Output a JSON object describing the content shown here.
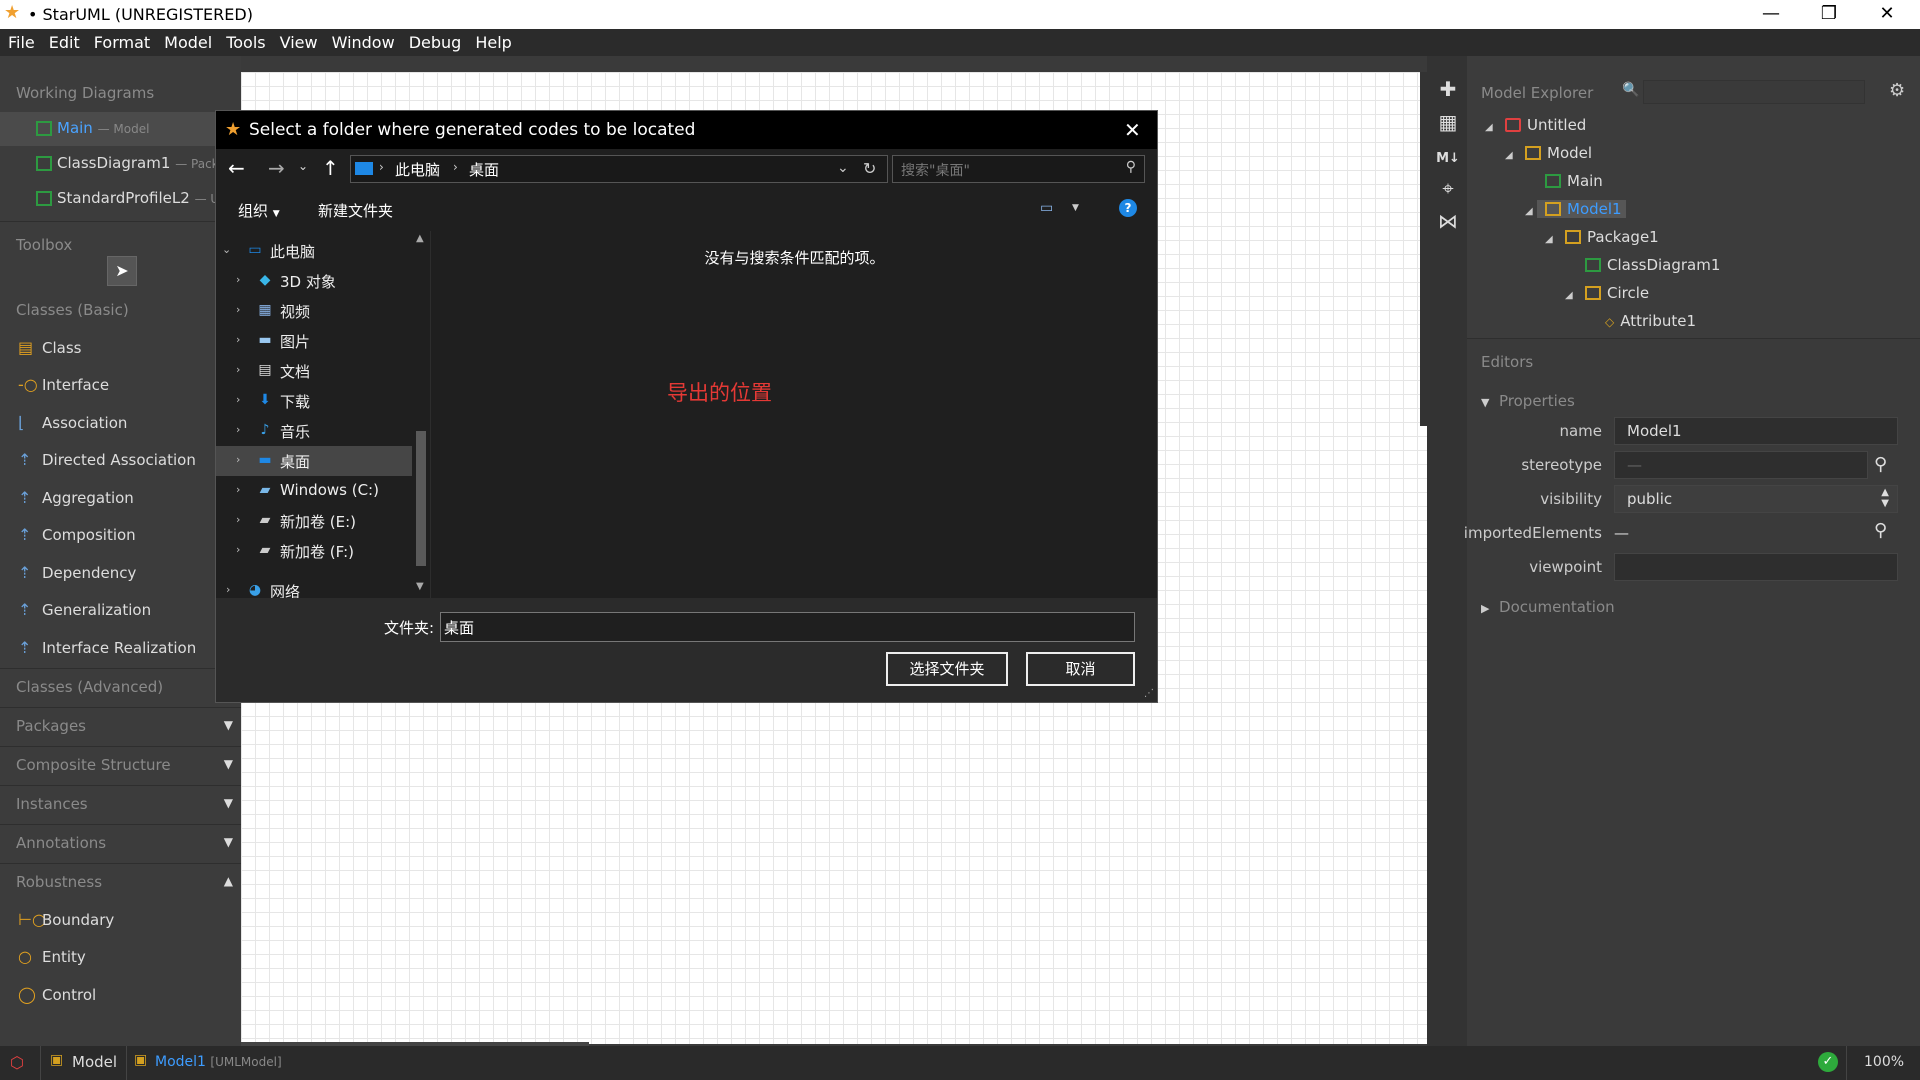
{
  "window": {
    "title": "• StarUML (UNREGISTERED)",
    "controls": [
      "minimize-icon",
      "restore-icon",
      "close-icon"
    ]
  },
  "menu": [
    "File",
    "Edit",
    "Format",
    "Model",
    "Tools",
    "View",
    "Window",
    "Debug",
    "Help"
  ],
  "working_diagrams": {
    "title": "Working Diagrams",
    "items": [
      {
        "label": "Main",
        "sub": "— Model"
      },
      {
        "label": "ClassDiagram1",
        "sub": "— Packag"
      },
      {
        "label": "StandardProfileL2",
        "sub": "— UM"
      }
    ]
  },
  "toolbox": {
    "title": "Toolbox",
    "basic_title": "Classes (Basic)",
    "basic_items": [
      "Class",
      "Interface",
      "Association",
      "Directed Association",
      "Aggregation",
      "Composition",
      "Dependency",
      "Generalization",
      "Interface Realization"
    ],
    "advanced_title": "Classes (Advanced)",
    "categories": [
      "Packages",
      "Composite Structure",
      "Instances",
      "Annotations",
      "Robustness"
    ],
    "robustness_items": [
      "Boundary",
      "Entity",
      "Control"
    ]
  },
  "model_explorer": {
    "title": "Model Explorer",
    "tree": [
      {
        "label": "Untitled",
        "level": 0,
        "icon": "project-icon"
      },
      {
        "label": "Model",
        "level": 1,
        "icon": "model-icon"
      },
      {
        "label": "Main",
        "level": 2,
        "icon": "diagram-icon"
      },
      {
        "label": "Model1",
        "level": 2,
        "icon": "model-icon",
        "selected": true
      },
      {
        "label": "Package1",
        "level": 3,
        "icon": "package-icon"
      },
      {
        "label": "ClassDiagram1",
        "level": 4,
        "icon": "diagram-icon"
      },
      {
        "label": "Circle",
        "level": 4,
        "icon": "class-icon"
      },
      {
        "label": "Attribute1",
        "level": 5,
        "icon": "attribute-icon"
      }
    ]
  },
  "editors": {
    "title": "Editors",
    "properties_title": "Properties",
    "name_label": "name",
    "name_value": "Model1",
    "stereotype_label": "stereotype",
    "stereotype_value": "—",
    "visibility_label": "visibility",
    "visibility_value": "public",
    "imported_label": "importedElements",
    "imported_value": "—",
    "viewpoint_label": "viewpoint",
    "viewpoint_value": "",
    "documentation_title": "Documentation"
  },
  "statusbar": {
    "model_label": "Model",
    "selected_label": "Model1",
    "selected_type": "[UMLModel]",
    "zoom": "100%"
  },
  "dialog": {
    "title": "Select a folder where generated codes to be located",
    "breadcrumb": [
      "此电脑",
      "桌面"
    ],
    "search_placeholder": "搜索\"桌面\"",
    "organize": "组织",
    "new_folder": "新建文件夹",
    "nav_items": [
      {
        "label": "此电脑",
        "icon": "pc-icon",
        "expanded": true
      },
      {
        "label": "3D 对象",
        "icon": "3d-objects-icon"
      },
      {
        "label": "视频",
        "icon": "videos-icon"
      },
      {
        "label": "图片",
        "icon": "pictures-icon"
      },
      {
        "label": "文档",
        "icon": "documents-icon"
      },
      {
        "label": "下载",
        "icon": "downloads-icon"
      },
      {
        "label": "音乐",
        "icon": "music-icon"
      },
      {
        "label": "桌面",
        "icon": "desktop-icon",
        "selected": true
      },
      {
        "label": "Windows (C:)",
        "icon": "drive-c-icon"
      },
      {
        "label": "新加卷 (E:)",
        "icon": "drive-e-icon"
      },
      {
        "label": "新加卷 (F:)",
        "icon": "drive-f-icon"
      },
      {
        "label": "网络",
        "icon": "network-icon"
      }
    ],
    "empty_message": "没有与搜索条件匹配的项。",
    "annotation": "导出的位置",
    "folder_label": "文件夹:",
    "folder_value": "桌面",
    "select_button": "选择文件夹",
    "cancel_button": "取消"
  },
  "colors": {
    "accent_blue": "#1e88e5",
    "annotation_red": "#e53935",
    "diagram_green": "#2d9a41",
    "model_yellow": "#e0a020"
  }
}
